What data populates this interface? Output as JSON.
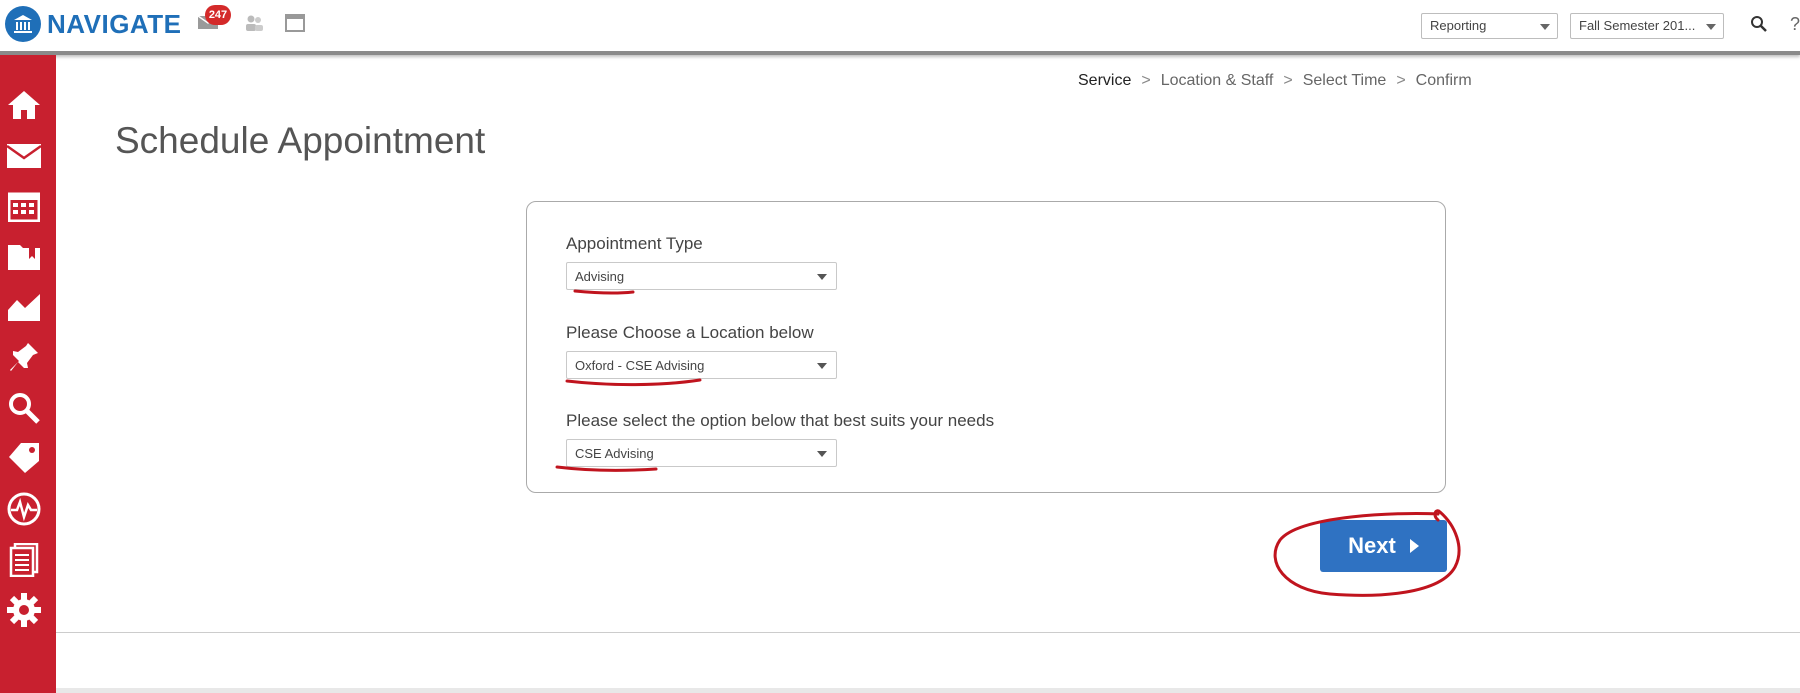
{
  "app": {
    "name": "NAVIGATE"
  },
  "topbar": {
    "badge_count": "247",
    "reporting_select": "Reporting",
    "term_select": "Fall Semester 201...",
    "help_label": "?"
  },
  "sidebar": {
    "items": [
      "home-icon",
      "mail-icon",
      "calendar-icon",
      "folder-icon",
      "chart-icon",
      "pin-icon",
      "search-icon",
      "tag-icon",
      "activity-icon",
      "reports-icon",
      "gear-icon"
    ]
  },
  "breadcrumb": {
    "steps": [
      "Service",
      "Location & Staff",
      "Select Time",
      "Confirm"
    ],
    "separator": ">"
  },
  "page": {
    "title": "Schedule Appointment"
  },
  "form": {
    "appointment_type": {
      "label": "Appointment Type",
      "value": "Advising"
    },
    "location": {
      "label": "Please Choose a Location below",
      "value": "Oxford - CSE Advising"
    },
    "option": {
      "label": "Please select the option below that best suits your needs",
      "value": "CSE Advising"
    }
  },
  "actions": {
    "next_label": "Next"
  },
  "colors": {
    "brand_blue": "#1f6fb8",
    "sidebar_red": "#c8202f",
    "button_blue": "#2f72c2",
    "annotation_red": "#c0141e"
  }
}
